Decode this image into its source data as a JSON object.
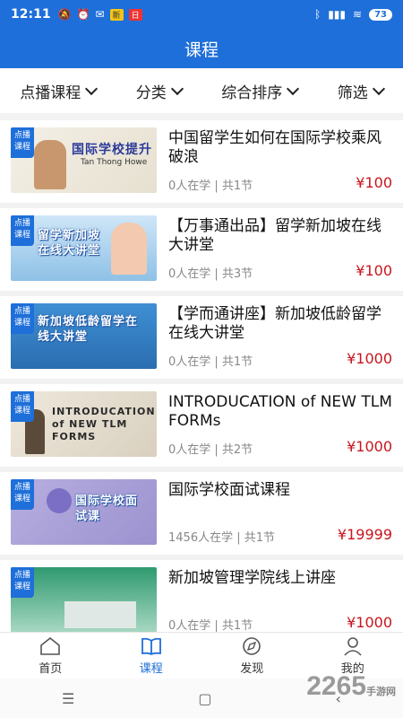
{
  "status": {
    "time": "12:11",
    "battery": "73",
    "badge1": "新",
    "badge2": "日"
  },
  "header": {
    "title": "课程"
  },
  "filters": [
    {
      "label": "点播课程"
    },
    {
      "label": "分类"
    },
    {
      "label": "综合排序"
    },
    {
      "label": "筛选"
    }
  ],
  "courses": [
    {
      "tag": "点播课程",
      "thumb_text": "国际学校提升",
      "thumb_sub": "Tan Thong Howe",
      "title": "中国留学生如何在国际学校乘风破浪",
      "meta": "0人在学 | 共1节",
      "price": "¥100"
    },
    {
      "tag": "点播课程",
      "thumb_text": "留学新加坡在线大讲堂",
      "thumb_sub": "",
      "title": "【万事通出品】留学新加坡在线大讲堂",
      "meta": "0人在学 | 共3节",
      "price": "¥100"
    },
    {
      "tag": "点播课程",
      "thumb_text": "新加坡低龄留学在线大讲堂",
      "thumb_sub": "",
      "title": "【学而通讲座】新加坡低龄留学在线大讲堂",
      "meta": "0人在学 | 共1节",
      "price": "¥1000"
    },
    {
      "tag": "点播课程",
      "thumb_text": "INTRODUCATION of NEW TLM FORMS",
      "thumb_sub": "",
      "title": "INTRODUCATION of NEW TLM FORMs",
      "meta": "0人在学 | 共2节",
      "price": "¥1000"
    },
    {
      "tag": "点播课程",
      "thumb_text": "国际学校面试课",
      "thumb_sub": "",
      "title": "国际学校面试课程",
      "meta": "1456人在学 | 共1节",
      "price": "¥19999"
    },
    {
      "tag": "点播课程",
      "thumb_text": "",
      "thumb_sub": "",
      "title": "新加坡管理学院线上讲座",
      "meta": "0人在学 | 共1节",
      "price": "¥1000"
    }
  ],
  "tabs": [
    {
      "label": "首页",
      "icon": "home-icon"
    },
    {
      "label": "课程",
      "icon": "book-icon"
    },
    {
      "label": "发现",
      "icon": "compass-icon"
    },
    {
      "label": "我的",
      "icon": "user-icon"
    }
  ],
  "watermark": {
    "text": "2265",
    "sub": "手游网"
  },
  "colors": {
    "primary": "#1e6fd9",
    "price": "#c8161d"
  }
}
